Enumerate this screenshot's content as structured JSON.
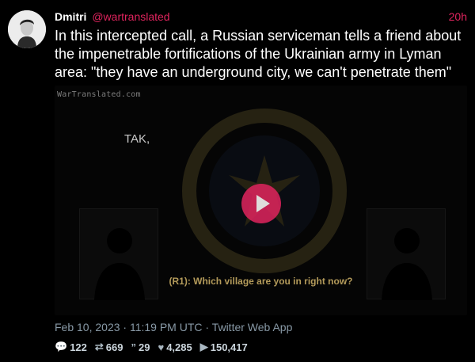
{
  "author": {
    "name": "Dmitri",
    "handle": "@wartranslated",
    "time": "20h"
  },
  "tweet_text": "In this intercepted call, a Russian serviceman tells a friend about the impenetrable fortifications of the Ukrainian army in Lyman area: \"they have an underground city, we can't penetrate them\"",
  "media": {
    "watermark": "WarTranslated.com",
    "top_caption": "TAK,",
    "subtitle": "(R1): Which village are you in right now?"
  },
  "meta": "Feb 10, 2023 · 11:19 PM UTC · Twitter Web App",
  "stats": {
    "replies": "122",
    "retweets": "669",
    "quotes": "29",
    "likes": "4,285",
    "views": "150,417"
  },
  "colors": {
    "accent": "#e0245e",
    "muted": "#8899a6",
    "subtitle": "#b39a5a"
  },
  "icons": [
    "comment-icon",
    "retweet-icon",
    "quote-icon",
    "heart-icon",
    "play-views-icon"
  ]
}
